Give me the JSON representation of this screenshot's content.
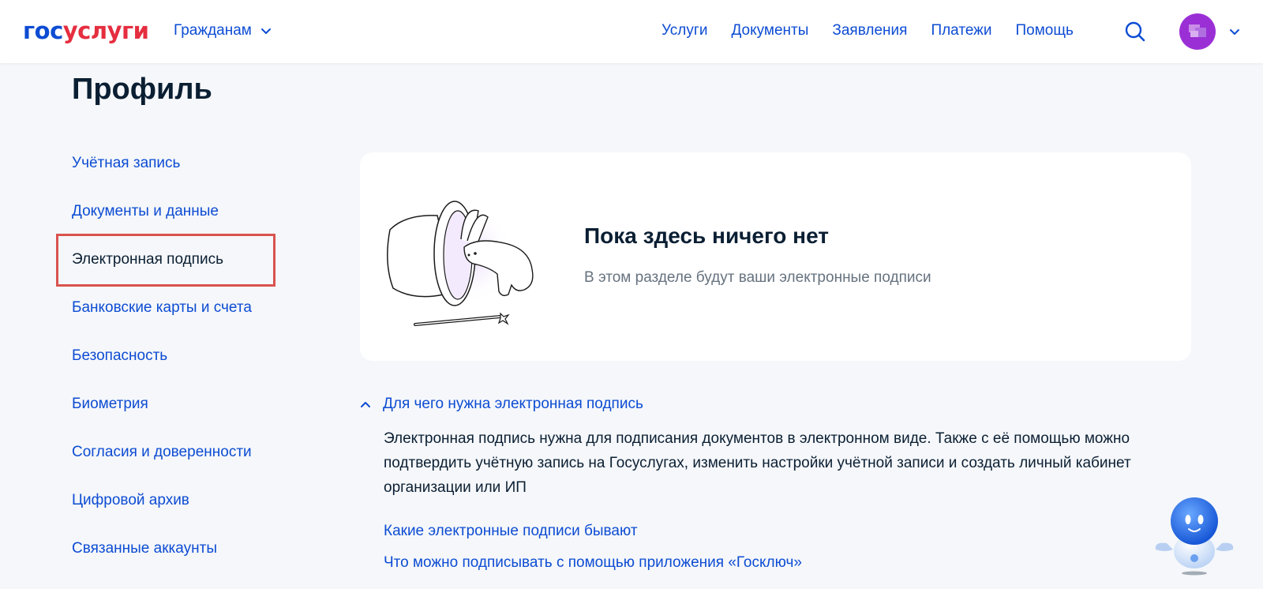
{
  "header": {
    "logo_part1": "гос",
    "logo_part2": "услуги",
    "citizens_label": "Гражданам",
    "nav": [
      "Услуги",
      "Документы",
      "Заявления",
      "Платежи",
      "Помощь"
    ]
  },
  "page": {
    "title": "Профиль"
  },
  "sidebar": {
    "items": [
      {
        "label": "Учётная запись"
      },
      {
        "label": "Документы и данные"
      },
      {
        "label": "Электронная подпись",
        "active": true
      },
      {
        "label": "Банковские карты и счета"
      },
      {
        "label": "Безопасность"
      },
      {
        "label": "Биометрия"
      },
      {
        "label": "Согласия и доверенности"
      },
      {
        "label": "Цифровой архив"
      },
      {
        "label": "Связанные аккаунты"
      }
    ]
  },
  "empty_state": {
    "title": "Пока здесь ничего нет",
    "subtitle": "В этом разделе будут ваши электронные подписи"
  },
  "accordion": {
    "heading": "Для чего нужна электронная подпись",
    "body": "Электронная подпись нужна для подписания документов в электронном виде. Также с её помощью можно подтвердить учётную запись на Госуслугах, изменить настройки учётной записи и создать личный кабинет организации или ИП"
  },
  "links": {
    "kinds": "Какие электронные подписи бывают",
    "goskey": "Что можно подписывать с помощью приложения «Госключ»"
  },
  "colors": {
    "brand_blue": "#0d4cd3",
    "brand_red": "#e52e3f",
    "text_dark": "#0b1f33",
    "text_muted": "#66727f",
    "background": "#f5f7fa",
    "highlight_red": "#d9534f",
    "avatar_purple": "#9b2fd6"
  },
  "icons": {
    "search": "search-icon",
    "chevron": "chevron-down-icon",
    "accordion": "chevron-up-icon",
    "assistant": "robot-assistant-icon",
    "illustration": "magic-hat-rabbit-illustration"
  }
}
